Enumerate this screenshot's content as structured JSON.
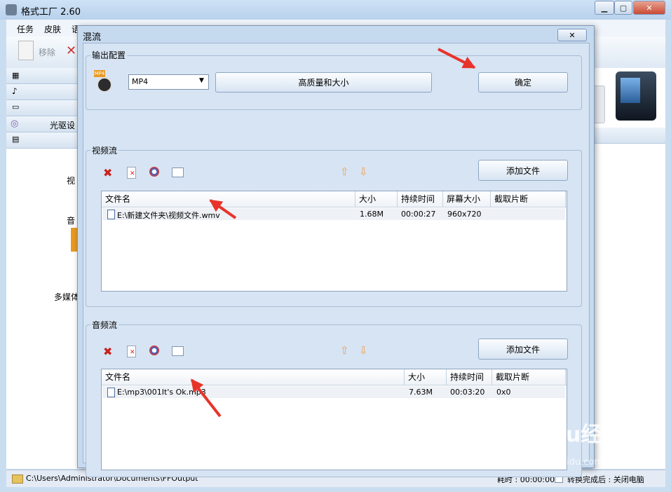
{
  "app": {
    "title": "格式工厂 2.60"
  },
  "menubar": {
    "items": [
      "任务",
      "皮肤",
      "语"
    ]
  },
  "toolbar": {
    "remove_label": "移除"
  },
  "left_panel": {
    "items": [
      "",
      "",
      "",
      "光驱设",
      ""
    ],
    "labels": [
      "视",
      "音",
      "多媒体"
    ]
  },
  "statusbar": {
    "path": "C:\\Users\\Administrator\\Documents\\FFOutput",
    "elapsed": "耗时 : 00:00:00",
    "after_done": "转换完成后 : 关闭电脑"
  },
  "dialog": {
    "title": "混流",
    "close_icon": "close-icon",
    "output": {
      "group_label": "输出配置",
      "format_value": "MP4",
      "quality_button": "高质量和大小",
      "ok_button": "确定"
    },
    "video": {
      "group_label": "视频流",
      "add_button": "添加文件",
      "columns": [
        "文件名",
        "大小",
        "持续时间",
        "屏幕大小",
        "截取片断"
      ],
      "rows": [
        {
          "file": "E:\\新建文件夹\\视频文件.wmv",
          "size": "1.68M",
          "duration": "00:00:27",
          "screen": "960x720",
          "clip": ""
        }
      ]
    },
    "audio": {
      "group_label": "音频流",
      "add_button": "添加文件",
      "columns": [
        "文件名",
        "大小",
        "持续时间",
        "截取片断"
      ],
      "rows": [
        {
          "file": "E:\\mp3\\001It's Ok.mp3",
          "size": "7.63M",
          "duration": "00:03:20",
          "clip": "0x0"
        }
      ]
    }
  },
  "watermark": {
    "brand": "Baidu经验",
    "url": "jingyan.baidu.com"
  },
  "colors": {
    "accent": "#e8332a",
    "window": "#c9ddf0"
  }
}
